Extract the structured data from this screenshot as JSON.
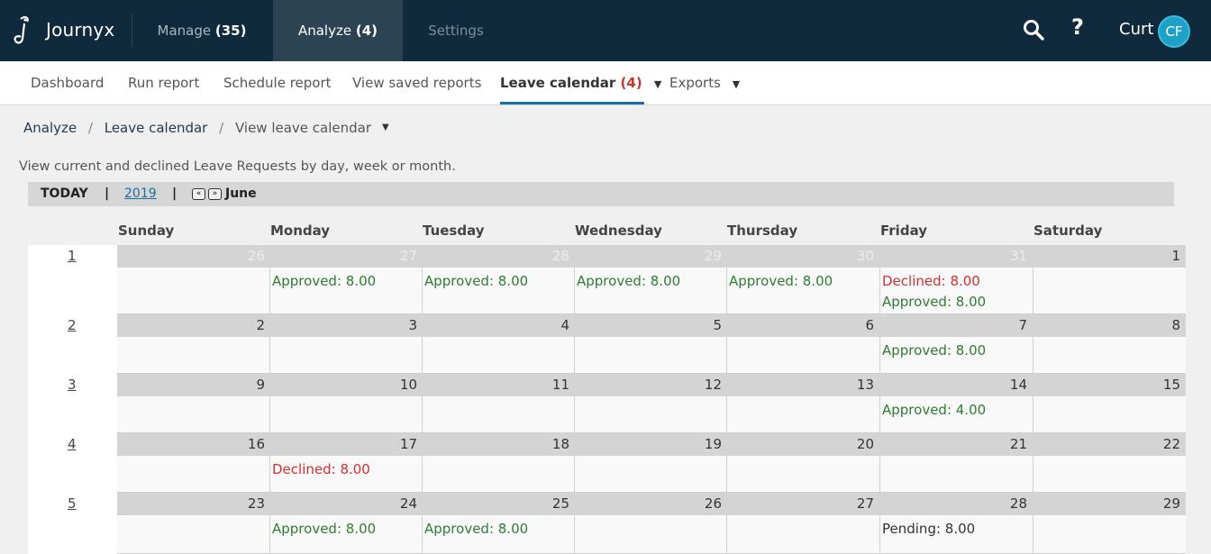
{
  "app": {
    "name": "Journyx",
    "nav": {
      "manage_label": "Manage",
      "manage_count": "(35)",
      "analyze_label": "Analyze",
      "analyze_count": "(4)",
      "settings_label": "Settings"
    },
    "user_name": "Curt",
    "user_initials": "CF",
    "help_glyph": "?"
  },
  "subnav": {
    "dashboard": "Dashboard",
    "run_report": "Run report",
    "schedule_report": "Schedule report",
    "view_saved_reports": "View saved reports",
    "leave_calendar": "Leave calendar",
    "leave_calendar_count": "(4)",
    "exports": "Exports"
  },
  "breadcrumb": {
    "root": "Analyze",
    "section": "Leave calendar",
    "current": "View leave calendar"
  },
  "description": "View current and declined Leave Requests by day, week or month.",
  "toolbar": {
    "today": "TODAY",
    "separator": "|",
    "year": "2019",
    "prev_glyph": "«",
    "next_glyph": "»",
    "month": "June"
  },
  "calendar": {
    "days_of_week": [
      "Sunday",
      "Monday",
      "Tuesday",
      "Wednesday",
      "Thursday",
      "Friday",
      "Saturday"
    ],
    "weeks": [
      {
        "label": "1",
        "days": [
          {
            "date": "26",
            "other_month": true,
            "entries": []
          },
          {
            "date": "27",
            "other_month": true,
            "entries": [
              {
                "status": "approved",
                "text": "Approved: 8.00"
              }
            ]
          },
          {
            "date": "28",
            "other_month": true,
            "entries": [
              {
                "status": "approved",
                "text": "Approved: 8.00"
              }
            ]
          },
          {
            "date": "29",
            "other_month": true,
            "entries": [
              {
                "status": "approved",
                "text": "Approved: 8.00"
              }
            ]
          },
          {
            "date": "30",
            "other_month": true,
            "entries": [
              {
                "status": "approved",
                "text": "Approved: 8.00"
              }
            ]
          },
          {
            "date": "31",
            "other_month": true,
            "entries": [
              {
                "status": "declined",
                "text": "Declined: 8.00"
              },
              {
                "status": "approved",
                "text": "Approved: 8.00"
              }
            ]
          },
          {
            "date": "1",
            "other_month": false,
            "entries": []
          }
        ]
      },
      {
        "label": "2",
        "days": [
          {
            "date": "2",
            "other_month": false,
            "entries": []
          },
          {
            "date": "3",
            "other_month": false,
            "entries": []
          },
          {
            "date": "4",
            "other_month": false,
            "entries": []
          },
          {
            "date": "5",
            "other_month": false,
            "entries": []
          },
          {
            "date": "6",
            "other_month": false,
            "entries": []
          },
          {
            "date": "7",
            "other_month": false,
            "entries": [
              {
                "status": "approved",
                "text": "Approved: 8.00"
              }
            ]
          },
          {
            "date": "8",
            "other_month": false,
            "entries": []
          }
        ]
      },
      {
        "label": "3",
        "days": [
          {
            "date": "9",
            "other_month": false,
            "entries": []
          },
          {
            "date": "10",
            "other_month": false,
            "entries": []
          },
          {
            "date": "11",
            "other_month": false,
            "entries": []
          },
          {
            "date": "12",
            "other_month": false,
            "entries": []
          },
          {
            "date": "13",
            "other_month": false,
            "entries": []
          },
          {
            "date": "14",
            "other_month": false,
            "entries": [
              {
                "status": "approved",
                "text": "Approved: 4.00"
              }
            ]
          },
          {
            "date": "15",
            "other_month": false,
            "entries": []
          }
        ]
      },
      {
        "label": "4",
        "days": [
          {
            "date": "16",
            "other_month": false,
            "entries": []
          },
          {
            "date": "17",
            "other_month": false,
            "entries": [
              {
                "status": "declined",
                "text": "Declined: 8.00"
              }
            ]
          },
          {
            "date": "18",
            "other_month": false,
            "entries": []
          },
          {
            "date": "19",
            "other_month": false,
            "entries": []
          },
          {
            "date": "20",
            "other_month": false,
            "entries": []
          },
          {
            "date": "21",
            "other_month": false,
            "entries": []
          },
          {
            "date": "22",
            "other_month": false,
            "entries": []
          }
        ]
      },
      {
        "label": "5",
        "days": [
          {
            "date": "23",
            "other_month": false,
            "entries": []
          },
          {
            "date": "24",
            "other_month": false,
            "entries": [
              {
                "status": "approved",
                "text": "Approved: 8.00"
              }
            ]
          },
          {
            "date": "25",
            "other_month": false,
            "entries": [
              {
                "status": "approved",
                "text": "Approved: 8.00"
              }
            ]
          },
          {
            "date": "26",
            "other_month": false,
            "entries": []
          },
          {
            "date": "27",
            "other_month": false,
            "entries": []
          },
          {
            "date": "28",
            "other_month": false,
            "entries": [
              {
                "status": "pending",
                "text": "Pending: 8.00"
              }
            ]
          },
          {
            "date": "29",
            "other_month": false,
            "entries": []
          }
        ]
      }
    ]
  },
  "colors": {
    "topbar": "#0e2a3c",
    "active_tab": "#2b4353",
    "approved": "#2e7d32",
    "declined": "#d32f2f",
    "pending": "#333333",
    "accent": "#1b6ea8",
    "avatar": "#1ea1c6"
  },
  "icons": [
    "journyx-logo-icon",
    "search-icon",
    "help-icon",
    "caret-down-icon",
    "prev-month-icon",
    "next-month-icon"
  ]
}
